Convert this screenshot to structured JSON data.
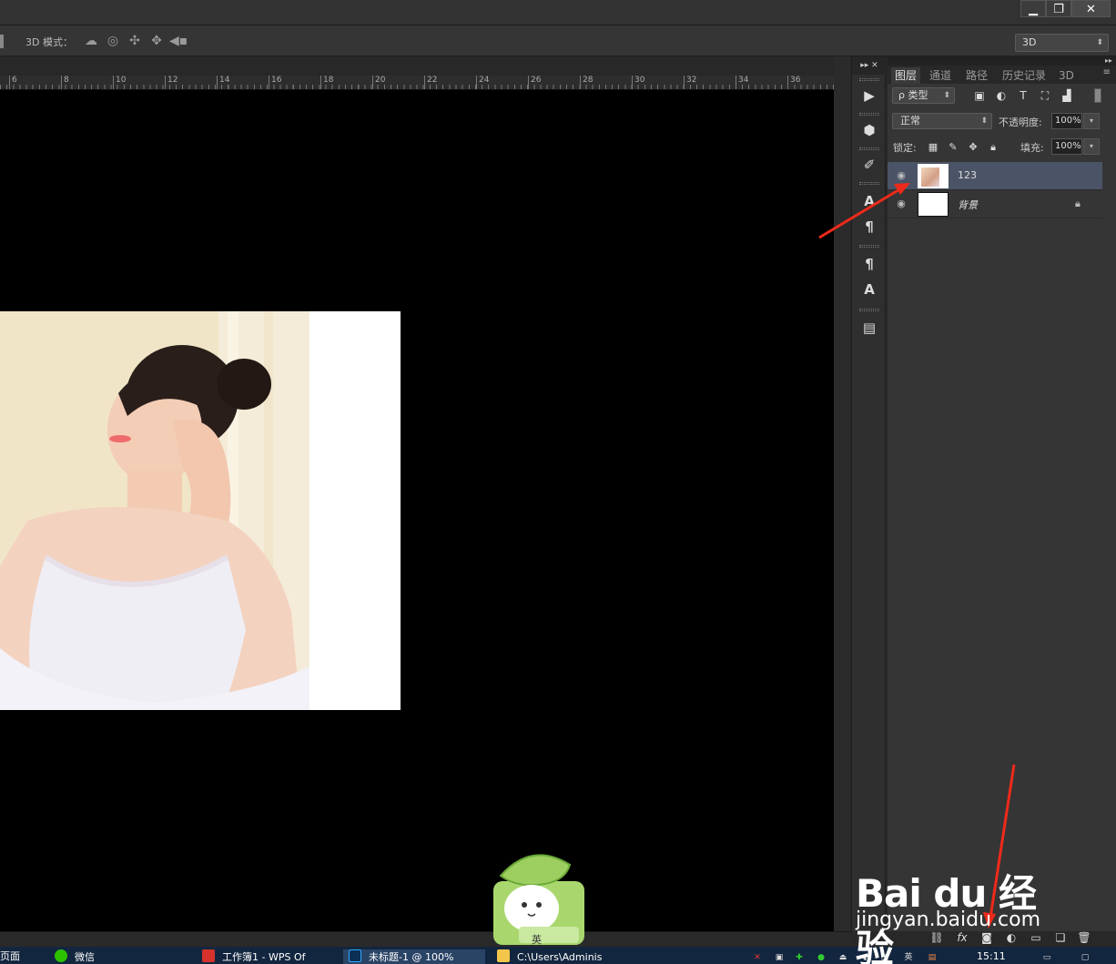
{
  "window": {
    "minimize_icon": "minimize-icon",
    "maximize_icon": "restore-icon",
    "close_icon": "close-icon"
  },
  "options_bar": {
    "mode_label": "3D 模式：",
    "mode_icons": [
      "rotate-3d-icon",
      "roll-3d-icon",
      "pan-3d-icon",
      "slide-3d-icon",
      "scale-3d-icon"
    ],
    "workspace": "3D"
  },
  "ruler": {
    "labels": [
      "6",
      "8",
      "10",
      "12",
      "14",
      "16",
      "18",
      "20",
      "22",
      "24",
      "26",
      "28",
      "30",
      "32",
      "34",
      "36"
    ]
  },
  "dock": {
    "header": "▸▸ ✕",
    "buttons": [
      "play-action-icon",
      "3d-cube-icon",
      "brush-tool-icon",
      "character-A-icon",
      "paragraph-icon",
      "paragraph-style-icon",
      "character-style-icon",
      "notes-icon"
    ]
  },
  "layers_panel": {
    "collapse": "▸▸",
    "tabs": [
      "图层",
      "通道",
      "路径",
      "历史记录",
      "3D"
    ],
    "active_tab": "图层",
    "menu_icon": "≡",
    "filter_label": "ρ 类型",
    "filter_icons": [
      "image-filter-icon",
      "adjustment-filter-icon",
      "type-filter-icon",
      "shape-filter-icon",
      "smart-object-filter-icon"
    ],
    "blend_mode": "正常",
    "opacity_label": "不透明度:",
    "opacity_value": "100%",
    "lock_label": "锁定:",
    "lock_icons": [
      "lock-transparent-icon",
      "lock-pixels-icon",
      "lock-position-icon",
      "lock-all-icon"
    ],
    "fill_label": "填充:",
    "fill_value": "100%",
    "layers": [
      {
        "name": "123",
        "selected": true,
        "visible": true,
        "locked": false
      },
      {
        "name": "背景",
        "selected": false,
        "visible": true,
        "locked": true
      }
    ],
    "footer_icons": [
      "link-layers-icon",
      "fx-icon",
      "add-mask-icon",
      "adjustment-layer-icon",
      "new-group-icon",
      "new-layer-icon",
      "delete-layer-icon"
    ],
    "fx_label": "fx"
  },
  "taskbar": {
    "items": [
      {
        "label": "页面",
        "active": false
      },
      {
        "label": "微信",
        "active": false
      },
      {
        "label": "工作簿1 - WPS Of",
        "active": false
      },
      {
        "label": "未标题-1 @ 100%",
        "active": true
      },
      {
        "label": "C:\\Users\\Adminis",
        "active": false
      }
    ],
    "clock": "15:11",
    "ime": "英"
  },
  "watermark": {
    "brand": "Bai du 经验",
    "url": "jingyan.baidu.com"
  },
  "colors": {
    "annotation_arrow": "#ee2a1a",
    "selected_layer": "#4b5366",
    "canvas": "#000000",
    "taskbar": "#13263f"
  }
}
